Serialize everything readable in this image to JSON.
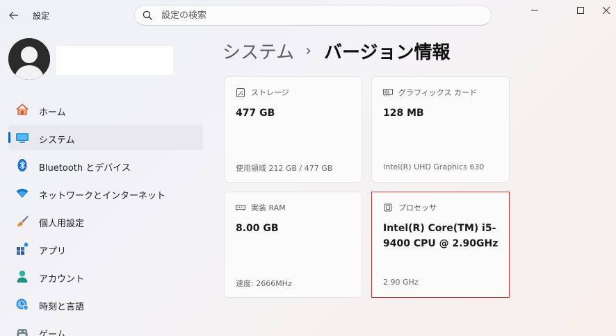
{
  "window": {
    "app_title": "設定",
    "search_placeholder": "設定の検索"
  },
  "sidebar": {
    "items": [
      {
        "label": "ホーム",
        "icon": "home-icon"
      },
      {
        "label": "システム",
        "icon": "system-icon",
        "active": true
      },
      {
        "label": "Bluetooth とデバイス",
        "icon": "bluetooth-icon"
      },
      {
        "label": "ネットワークとインターネット",
        "icon": "wifi-icon"
      },
      {
        "label": "個人用設定",
        "icon": "brush-icon"
      },
      {
        "label": "アプリ",
        "icon": "apps-icon"
      },
      {
        "label": "アカウント",
        "icon": "account-icon"
      },
      {
        "label": "時刻と言語",
        "icon": "clock-globe-icon"
      },
      {
        "label": "ゲーム",
        "icon": "gamepad-icon"
      }
    ]
  },
  "breadcrumb": {
    "parent": "システム",
    "separator": "›",
    "current": "バージョン情報"
  },
  "cards": {
    "storage": {
      "title": "ストレージ",
      "value": "477 GB",
      "sub": "使用領域 212 GB / 477 GB",
      "icon": "storage-icon"
    },
    "graphics": {
      "title": "グラフィックス カード",
      "value": "128 MB",
      "sub": "Intel(R) UHD Graphics 630",
      "icon": "graphics-card-icon"
    },
    "ram": {
      "title": "実装 RAM",
      "value": "8.00 GB",
      "sub": "速度: 2666MHz",
      "icon": "ram-icon"
    },
    "processor": {
      "title": "プロセッサ",
      "value": "Intel(R) Core(TM) i5-9400 CPU @ 2.90GHz",
      "sub": "2.90 GHz",
      "icon": "processor-icon"
    }
  },
  "colors": {
    "accent": "#0a63b8",
    "highlight_border": "#c8323a"
  }
}
